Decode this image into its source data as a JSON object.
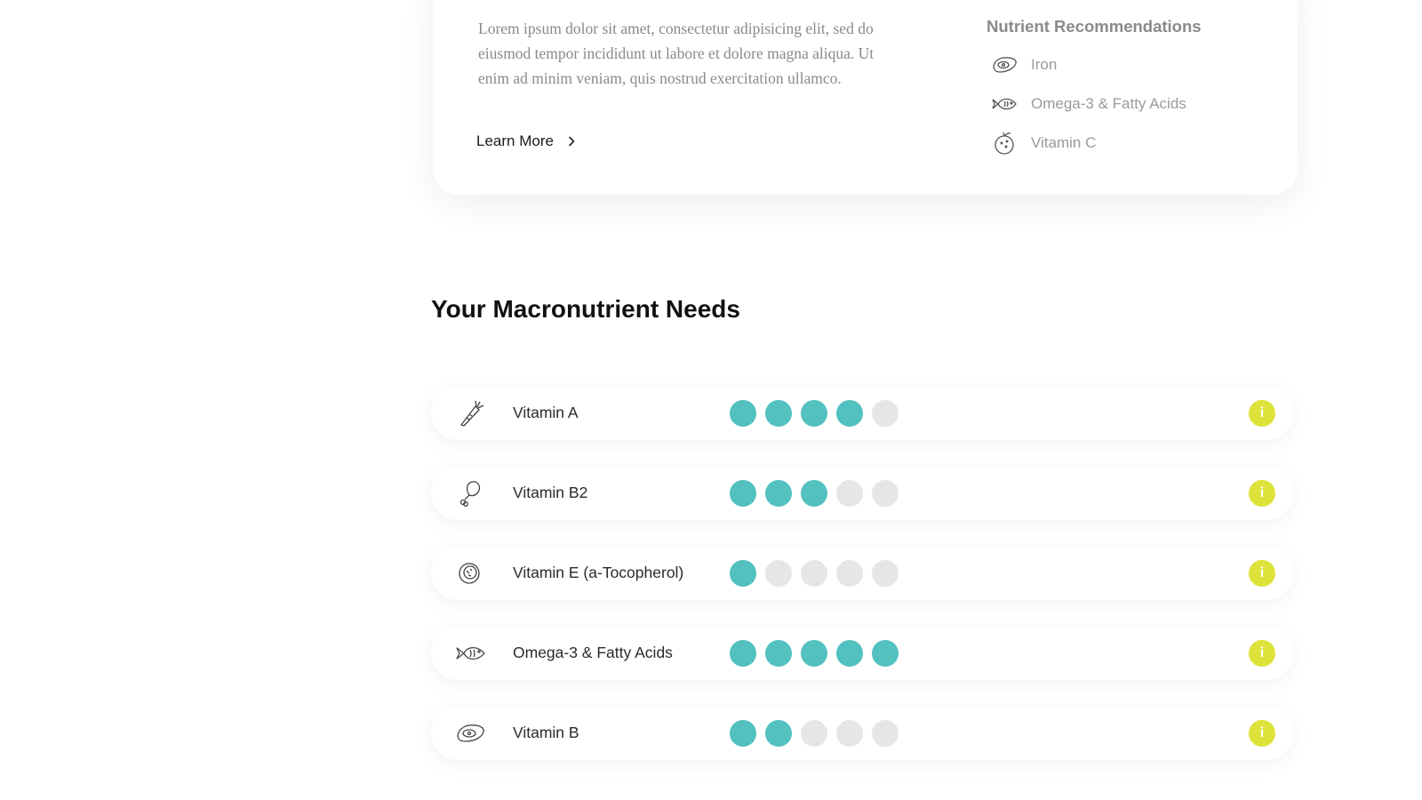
{
  "intro": {
    "body": "Lorem ipsum dolor sit amet, consectetur adipisicing elit, sed do eiusmod tempor incididunt ut labore et dolore magna aliqua. Ut enim ad minim veniam, quis nostrud exercitation ullamco.",
    "learn_more_label": "Learn More"
  },
  "recommendations": {
    "title": "Nutrient Recommendations",
    "items": [
      {
        "label": "Iron",
        "icon": "steak-icon"
      },
      {
        "label": "Omega-3 & Fatty Acids",
        "icon": "fish-icon"
      },
      {
        "label": "Vitamin C",
        "icon": "orange-icon"
      }
    ]
  },
  "macronutrients": {
    "title": "Your Macronutrient Needs",
    "max_level": 5,
    "info_label": "i",
    "rows": [
      {
        "label": "Vitamin A",
        "icon": "carrot-icon",
        "level": 4
      },
      {
        "label": "Vitamin B2",
        "icon": "chicken-leg-icon",
        "level": 3
      },
      {
        "label": "Vitamin E (a-Tocopherol)",
        "icon": "nut-icon",
        "level": 1
      },
      {
        "label": "Omega-3 & Fatty Acids",
        "icon": "fish-icon",
        "level": 5
      },
      {
        "label": "Vitamin B",
        "icon": "steak-icon",
        "level": 2
      }
    ]
  },
  "colors": {
    "accent_teal": "#52c1bf",
    "dot_empty": "#e6e6e6",
    "info_yellow": "#dde33a"
  }
}
